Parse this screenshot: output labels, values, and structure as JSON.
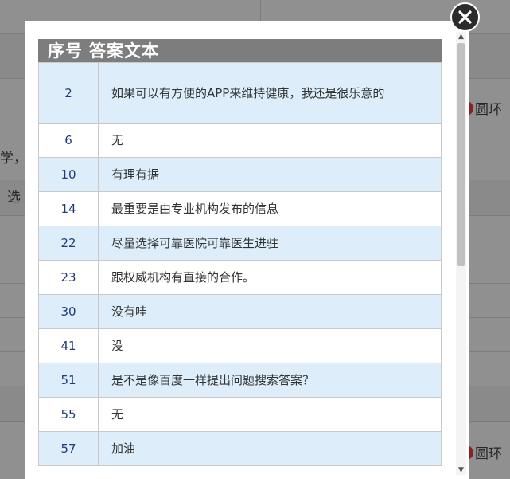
{
  "background": {
    "fragment_xue": "学，",
    "fragment_xuan": "选",
    "ring_label_top": "圆环",
    "ring_label_bottom": "圆环"
  },
  "modal": {
    "headers": {
      "index": "序号",
      "answer": "答案文本"
    },
    "rows": [
      {
        "index": "2",
        "text": "如果可以有方便的APP来维持健康，我还是很乐意的"
      },
      {
        "index": "6",
        "text": "无"
      },
      {
        "index": "10",
        "text": "有理有据"
      },
      {
        "index": "14",
        "text": "最重要是由专业机构发布的信息"
      },
      {
        "index": "22",
        "text": "尽量选择可靠医院可靠医生进驻"
      },
      {
        "index": "23",
        "text": "跟权威机构有直接的合作。"
      },
      {
        "index": "30",
        "text": "没有哇"
      },
      {
        "index": "41",
        "text": "没"
      },
      {
        "index": "51",
        "text": "是不是像百度一样提出问题搜索答案？"
      },
      {
        "index": "55",
        "text": "无"
      },
      {
        "index": "57",
        "text": "加油"
      }
    ]
  },
  "icons": {
    "close": "close-icon",
    "scroll_up": "scroll-up-arrow-icon",
    "scroll_down": "scroll-down-arrow-icon"
  },
  "colors": {
    "header_bg": "#7d7d7d",
    "row_blue": "#ddeefa",
    "index_text": "#1f3b7a",
    "overlay": "#8c8c8c"
  }
}
